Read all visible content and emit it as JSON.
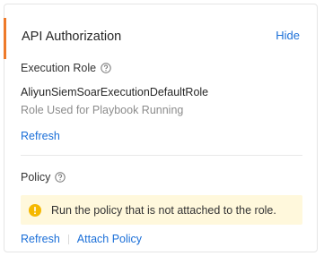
{
  "panel": {
    "title": "API Authorization",
    "hide_label": "Hide"
  },
  "execution_role": {
    "label": "Execution Role",
    "help_icon": "question-circle-icon",
    "role_name": "AliyunSiemSoarExecutionDefaultRole",
    "description": "Role Used for Playbook Running",
    "refresh_label": "Refresh"
  },
  "policy": {
    "label": "Policy",
    "help_icon": "question-circle-icon",
    "alert_icon": "warning-circle-icon",
    "alert_text": "Run the policy that is not attached to the role.",
    "refresh_label": "Refresh",
    "attach_label": "Attach Policy"
  },
  "colors": {
    "accent": "#ee7a2a",
    "link": "#1b6fd8",
    "warning_bg": "#fff8dc",
    "warning_icon": "#f5b800"
  }
}
